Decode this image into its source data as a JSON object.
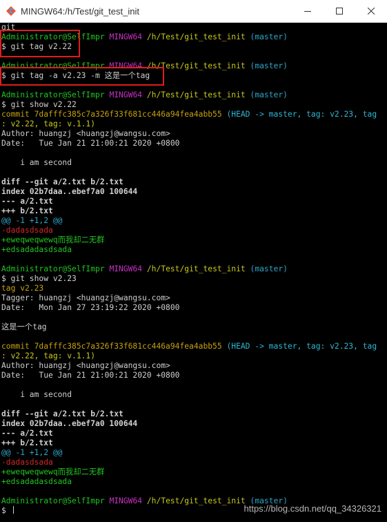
{
  "window": {
    "title": "MINGW64:/h/Test/git_test_init",
    "controls": {
      "minimize_icon": "minimize-icon",
      "maximize_icon": "maximize-icon",
      "close_icon": "close-icon"
    }
  },
  "terminal": {
    "lines": [
      {
        "type": "plain",
        "text": "git"
      },
      {
        "type": "prompt",
        "user": "Administrator@SelfImpr",
        "sys": "MINGW64",
        "path": "/h/Test/git_test_init",
        "branch": "(master)"
      },
      {
        "type": "cmd",
        "text": "$ git tag v2.22"
      },
      {
        "type": "blank"
      },
      {
        "type": "prompt",
        "user": "Administrator@SelfImpr",
        "sys": "MINGW64",
        "path": "/h/Test/git_test_init",
        "branch": "(master)"
      },
      {
        "type": "cmd",
        "text": "$ git tag -a v2.23 -m 这是一个tag"
      },
      {
        "type": "blank"
      },
      {
        "type": "prompt",
        "user": "Administrator@SelfImpr",
        "sys": "MINGW64",
        "path": "/h/Test/git_test_init",
        "branch": "(master)"
      },
      {
        "type": "cmd",
        "text": "$ git show v2.22"
      },
      {
        "type": "commit",
        "hash": "commit 7dafffc385c7a326f33f681cc446a94fea4abb55",
        "head": " (HEAD -> master, tag: v2.23, tag"
      },
      {
        "type": "commitcont",
        "text": ": v2.22, tag: v.1.1)"
      },
      {
        "type": "plain",
        "text": "Author: huangzj <huangzj@wangsu.com>"
      },
      {
        "type": "plain",
        "text": "Date:   Tue Jan 21 21:00:21 2020 +0800"
      },
      {
        "type": "blank"
      },
      {
        "type": "plain",
        "text": "    i am second"
      },
      {
        "type": "blank"
      },
      {
        "type": "bold",
        "text": "diff --git a/2.txt b/2.txt"
      },
      {
        "type": "bold",
        "text": "index 02b7daa..ebef7a0 100644"
      },
      {
        "type": "bold",
        "text": "--- a/2.txt"
      },
      {
        "type": "bold",
        "text": "+++ b/2.txt"
      },
      {
        "type": "hunk",
        "text": "@@ -1 +1,2 @@"
      },
      {
        "type": "del",
        "text": "-dadasdsada"
      },
      {
        "type": "add",
        "text": "+eweqweqwewq而我却二无群"
      },
      {
        "type": "add",
        "text": "+edsadadasdsada"
      },
      {
        "type": "blank"
      },
      {
        "type": "prompt",
        "user": "Administrator@SelfImpr",
        "sys": "MINGW64",
        "path": "/h/Test/git_test_init",
        "branch": "(master)"
      },
      {
        "type": "cmd",
        "text": "$ git show v2.23"
      },
      {
        "type": "tagline",
        "text": "tag v2.23"
      },
      {
        "type": "plain",
        "text": "Tagger: huangzj <huangzj@wangsu.com>"
      },
      {
        "type": "plain",
        "text": "Date:   Mon Jan 27 23:19:22 2020 +0800"
      },
      {
        "type": "blank"
      },
      {
        "type": "plain",
        "text": "这是一个tag"
      },
      {
        "type": "blank"
      },
      {
        "type": "commit",
        "hash": "commit 7dafffc385c7a326f33f681cc446a94fea4abb55",
        "head": " (HEAD -> master, tag: v2.23, tag"
      },
      {
        "type": "commitcont",
        "text": ": v2.22, tag: v.1.1)"
      },
      {
        "type": "plain",
        "text": "Author: huangzj <huangzj@wangsu.com>"
      },
      {
        "type": "plain",
        "text": "Date:   Tue Jan 21 21:00:21 2020 +0800"
      },
      {
        "type": "blank"
      },
      {
        "type": "plain",
        "text": "    i am second"
      },
      {
        "type": "blank"
      },
      {
        "type": "bold",
        "text": "diff --git a/2.txt b/2.txt"
      },
      {
        "type": "bold",
        "text": "index 02b7daa..ebef7a0 100644"
      },
      {
        "type": "bold",
        "text": "--- a/2.txt"
      },
      {
        "type": "bold",
        "text": "+++ b/2.txt"
      },
      {
        "type": "hunk",
        "text": "@@ -1 +1,2 @@"
      },
      {
        "type": "del",
        "text": "-dadasdsada"
      },
      {
        "type": "add",
        "text": "+eweqweqwewq而我却二无群"
      },
      {
        "type": "add",
        "text": "+edsadadasdsada"
      },
      {
        "type": "blank"
      },
      {
        "type": "prompt",
        "user": "Administrator@SelfImpr",
        "sys": "MINGW64",
        "path": "/h/Test/git_test_init",
        "branch": "(master)"
      },
      {
        "type": "input",
        "text": "$ "
      }
    ]
  },
  "watermark": "https://blog.csdn.net/qq_34326321",
  "colors": {
    "user": "#21c521",
    "mingw": "#c82fc8",
    "path": "#c9c920",
    "branch": "#2fa6c8",
    "commit": "#c7a20e",
    "deleted": "#d02727",
    "added": "#21c521",
    "highlight_box": "#e01d1d"
  }
}
